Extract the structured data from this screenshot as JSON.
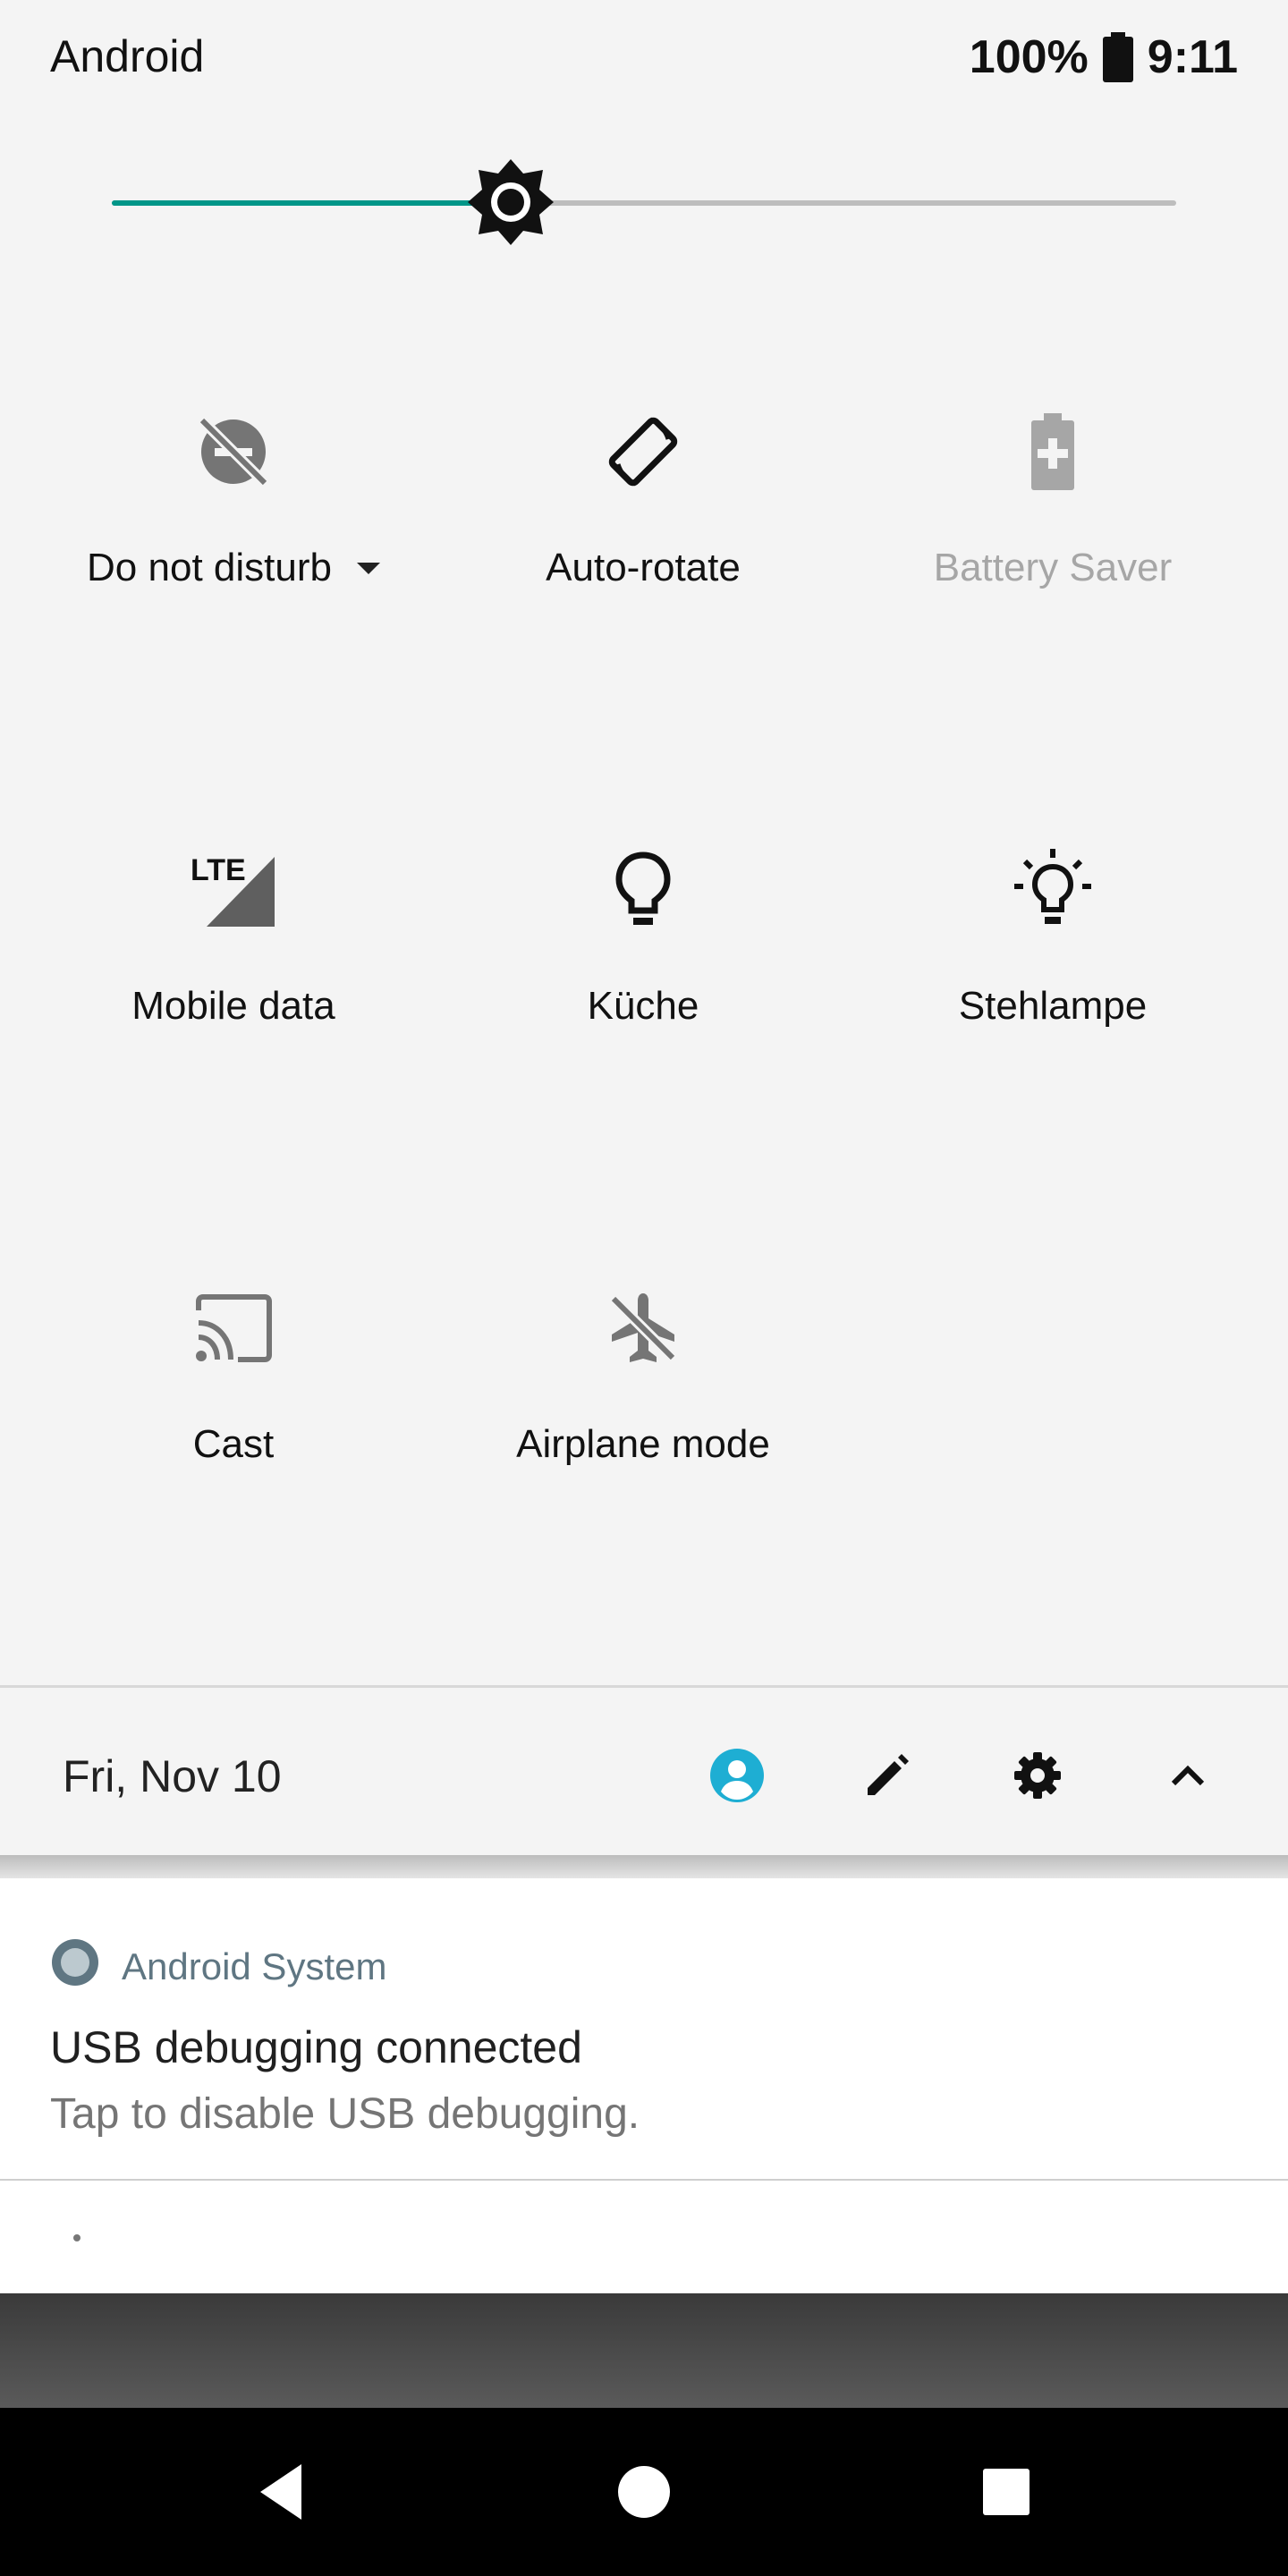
{
  "status_bar": {
    "carrier": "Android",
    "battery": "100%",
    "time": "9:11"
  },
  "brightness": {
    "level": 0.375,
    "accent": "#009688"
  },
  "tiles": [
    {
      "label": "Do not disturb",
      "icon": "do-not-disturb-off-icon",
      "state": "off",
      "has_dropdown": true
    },
    {
      "label": "Auto-rotate",
      "icon": "screen-rotation-icon",
      "state": "on"
    },
    {
      "label": "Battery Saver",
      "icon": "battery-charging-icon",
      "state": "unavailable"
    },
    {
      "label": "Mobile data",
      "icon": "lte-signal-icon",
      "state": "on"
    },
    {
      "label": "Küche",
      "icon": "lightbulb-icon",
      "state": "on"
    },
    {
      "label": "Stehlampe",
      "icon": "lightbulb-on-icon",
      "state": "on"
    },
    {
      "label": "Cast",
      "icon": "cast-icon",
      "state": "off"
    },
    {
      "label": "Airplane mode",
      "icon": "airplane-off-icon",
      "state": "off"
    }
  ],
  "footer": {
    "date": "Fri, Nov 10",
    "icons": [
      "user-icon",
      "edit-icon",
      "settings-icon",
      "collapse-icon"
    ],
    "user_color": "#1eaed3"
  },
  "notification": {
    "app": "Android System",
    "title": "USB debugging connected",
    "text": "Tap to disable USB debugging."
  },
  "nav": [
    "back-icon",
    "home-icon",
    "recents-icon"
  ]
}
